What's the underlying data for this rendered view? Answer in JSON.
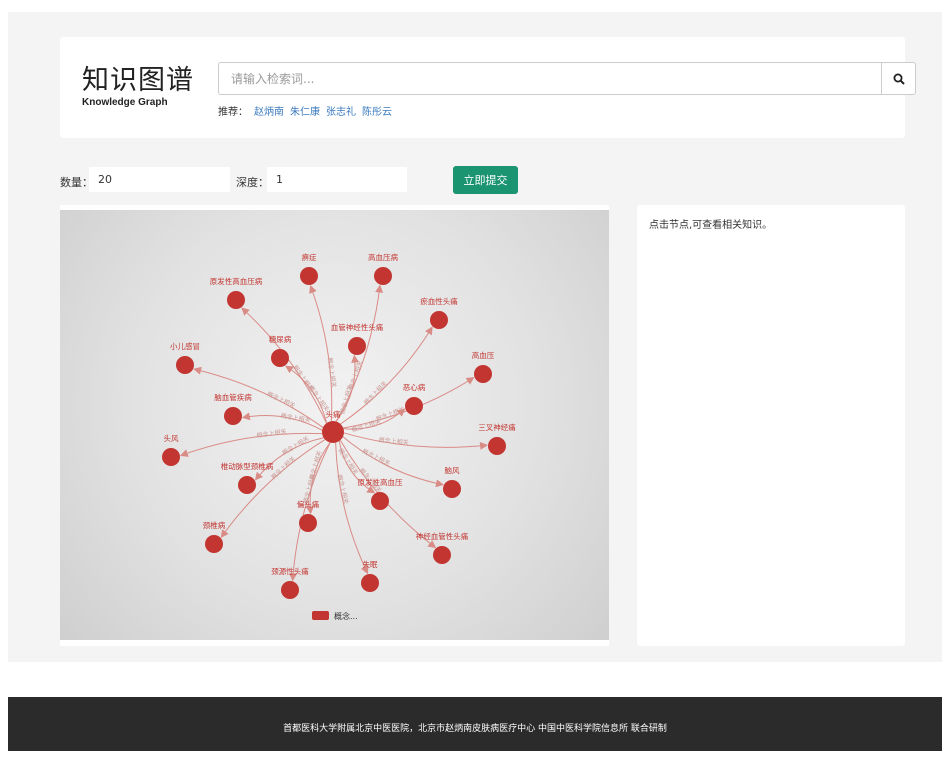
{
  "header": {
    "title_cn": "知识图谱",
    "title_en": "Knowledge Graph",
    "search_placeholder": "请输入检索词...",
    "recommend_label": "推荐：",
    "recommend_items": [
      "赵炳南",
      "朱仁康",
      "张志礼",
      "陈彤云"
    ]
  },
  "controls": {
    "count_label": "数量：",
    "count_value": "20",
    "depth_label": "深度：",
    "depth_value": "1",
    "submit_label": "立即提交"
  },
  "graph": {
    "center": "头痛",
    "edge_label": "概念上相关",
    "legend_label": "概念...",
    "node_color": "#c23531",
    "nodes": [
      "高血压病",
      "痹症",
      "原发性高血压病",
      "瘀血性头痛",
      "血管神经性头痛",
      "糖尿病",
      "小儿感冒",
      "高血压",
      "恶心病",
      "脑血管疾病",
      "三叉神经痛",
      "头风",
      "椎动脉型颈椎病",
      "脑风",
      "原发性高血压",
      "偏头痛",
      "颈椎病",
      "神经血管性头痛",
      "失眠",
      "颈源性头痛"
    ]
  },
  "info": {
    "text": "点击节点,可查看相关知识。"
  },
  "footer": {
    "text": "首都医科大学附属北京中医医院，北京市赵炳南皮肤病医疗中心 中国中医科学院信息所 联合研制"
  }
}
